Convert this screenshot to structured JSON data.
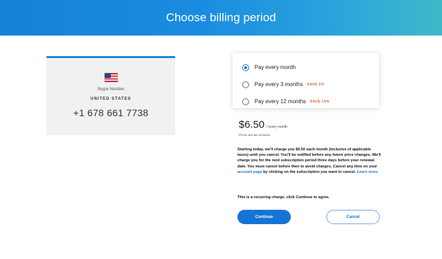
{
  "header": {
    "title": "Choose billing period"
  },
  "number_card": {
    "flag_icon": "us-flag-icon",
    "label": "Skype Number",
    "country": "UNITED STATES",
    "phone_number": "+1 678 661 7738"
  },
  "billing_options": [
    {
      "label": "Pay every month",
      "badge": "",
      "selected": true
    },
    {
      "label": "Pay every 3 months",
      "badge": "SAVE 5%",
      "selected": false
    },
    {
      "label": "Pay every 12 months",
      "badge": "SAVE 15%",
      "selected": false
    }
  ],
  "price": {
    "amount": "$6.50",
    "period": "/ every month",
    "note": "Prices are tax inclusive"
  },
  "terms": {
    "text_before": "Starting today, we'll charge you $6.50 each month (inclusive of applicable taxes) until you cancel. You'll be notified before any future price changes. We'll charge you for the next subscription period three days before your renewal date. You must cancel before then to avoid charges. Cancel any time on your ",
    "account_link": "account page",
    "text_middle": " by clicking on the subscription you want to cancel. ",
    "learn_more_link": "Learn more"
  },
  "recurring_note": "This is a recurring charge, click Continue to agree.",
  "buttons": {
    "continue_label": "Continue",
    "cancel_label": "Cancel"
  },
  "colors": {
    "accent": "#1574d4",
    "save_badge": "#d9622b",
    "card_bg": "#f1f1f1"
  }
}
